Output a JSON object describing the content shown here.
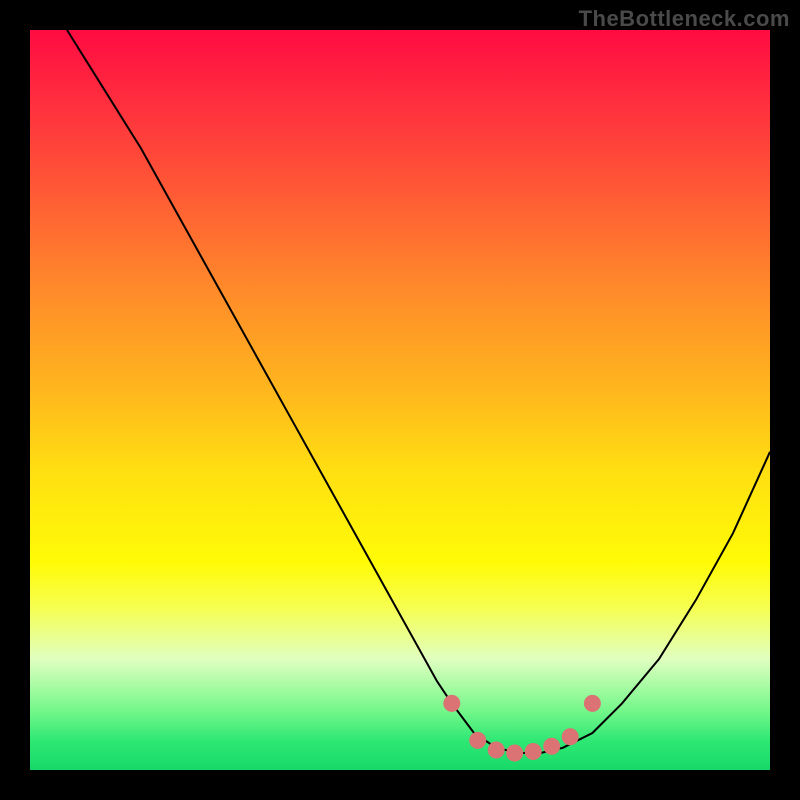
{
  "watermark": "TheBottleneck.com",
  "colors": {
    "frame": "#000000",
    "curve_stroke": "#000000",
    "marker_fill": "#db7374",
    "marker_stroke": "#db7374"
  },
  "chart_data": {
    "type": "line",
    "title": "",
    "xlabel": "",
    "ylabel": "",
    "xlim": [
      0,
      100
    ],
    "ylim": [
      0,
      100
    ],
    "grid": false,
    "legend": false,
    "series": [
      {
        "name": "curve",
        "x": [
          5,
          10,
          15,
          20,
          25,
          30,
          35,
          40,
          45,
          50,
          55,
          57,
          60,
          63,
          66,
          69,
          72,
          76,
          80,
          85,
          90,
          95,
          100
        ],
        "y": [
          100,
          92,
          84,
          75,
          66,
          57,
          48,
          39,
          30,
          21,
          12,
          9,
          5,
          3,
          2.3,
          2.3,
          3,
          5,
          9,
          15,
          23,
          32,
          43
        ]
      }
    ],
    "markers": {
      "comment": "salmon rounded markers near the valley plateau",
      "points": [
        {
          "x": 57,
          "y": 9
        },
        {
          "x": 60.5,
          "y": 4
        },
        {
          "x": 63,
          "y": 2.7
        },
        {
          "x": 65.5,
          "y": 2.3
        },
        {
          "x": 68,
          "y": 2.5
        },
        {
          "x": 70.5,
          "y": 3.2
        },
        {
          "x": 73,
          "y": 4.5
        },
        {
          "x": 76,
          "y": 9
        }
      ],
      "radius_px": 8
    }
  }
}
